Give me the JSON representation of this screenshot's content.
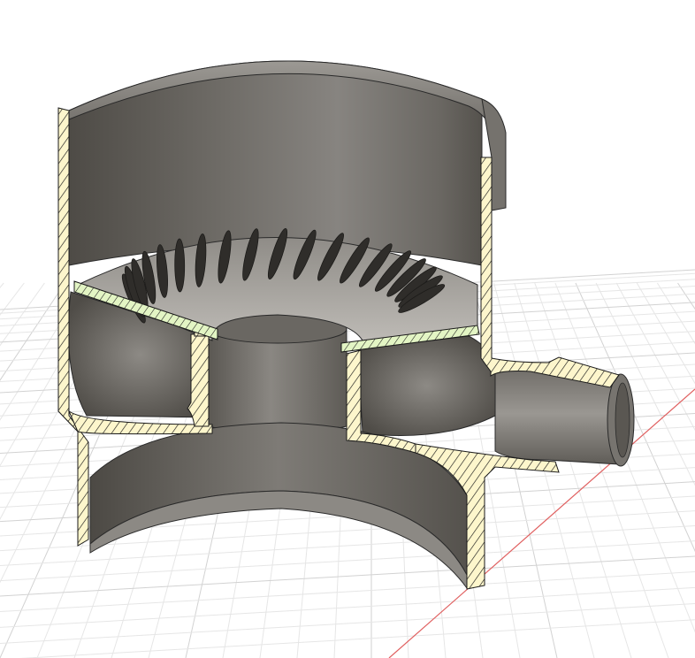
{
  "viewport": {
    "background": "#ffffff",
    "grid": true,
    "grid_minor_color": "#e6e6e6",
    "grid_major_color": "#d2d2d2",
    "axis_color": "#e06060"
  },
  "model": {
    "view": "section-cut",
    "hatch_color": "#fdf6cc",
    "hatch_stroke": "#1a1a1a",
    "secondary_hatch_color": "#e3f5c4",
    "surface_dark": "#57544f",
    "surface_mid": "#7d7a75",
    "surface_light": "#a7a49f",
    "grate_color": "#9e9b96",
    "slot_color": "#2f2d2a"
  }
}
